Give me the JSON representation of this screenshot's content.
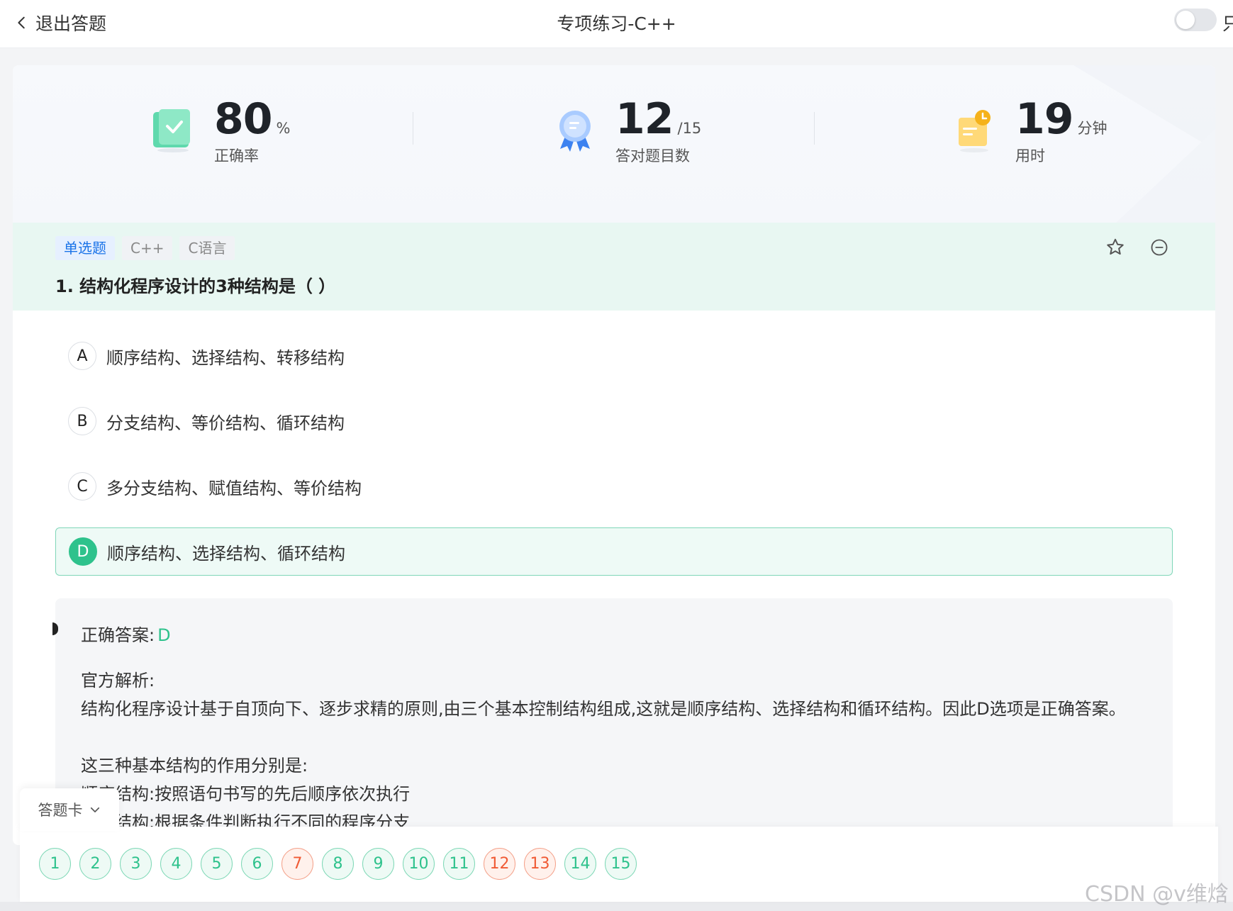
{
  "topbar": {
    "back_label": "退出答题",
    "title": "专项练习-C++",
    "toggle_label": "只"
  },
  "stats": {
    "accuracy": {
      "value": "80",
      "unit": "%",
      "label": "正确率"
    },
    "correct": {
      "value": "12",
      "unit": "/15",
      "label": "答对题目数"
    },
    "time": {
      "value": "19",
      "unit": "分钟",
      "label": "用时"
    }
  },
  "question": {
    "tags": [
      "单选题",
      "C++",
      "C语言"
    ],
    "title": "1. 结构化程序设计的3种结构是（ ）",
    "options": [
      {
        "letter": "A",
        "text": "顺序结构、选择结构、转移结构"
      },
      {
        "letter": "B",
        "text": "分支结构、等价结构、循环结构"
      },
      {
        "letter": "C",
        "text": "多分支结构、赋值结构、等价结构"
      },
      {
        "letter": "D",
        "text": "顺序结构、选择结构、循环结构"
      }
    ],
    "selected": "D"
  },
  "analysis": {
    "answer_label": "正确答案:",
    "answer_value": "D",
    "official_label": "官方解析:",
    "lines": [
      "结构化程序设计基于自顶向下、逐步求精的原则,由三个基本控制结构组成,这就是顺序结构、选择结构和循环结构。因此D选项是正确答案。",
      "",
      "这三种基本结构的作用分别是:",
      "顺序结构:按照语句书写的先后顺序依次执行",
      "选择结构:根据条件判断执行不同的程序分支"
    ]
  },
  "answer_sheet": {
    "label": "答题卡",
    "items": [
      {
        "n": "1",
        "status": "correct"
      },
      {
        "n": "2",
        "status": "correct"
      },
      {
        "n": "3",
        "status": "correct"
      },
      {
        "n": "4",
        "status": "correct"
      },
      {
        "n": "5",
        "status": "correct"
      },
      {
        "n": "6",
        "status": "correct"
      },
      {
        "n": "7",
        "status": "wrong"
      },
      {
        "n": "8",
        "status": "correct"
      },
      {
        "n": "9",
        "status": "correct"
      },
      {
        "n": "10",
        "status": "correct"
      },
      {
        "n": "11",
        "status": "correct"
      },
      {
        "n": "12",
        "status": "wrong"
      },
      {
        "n": "13",
        "status": "wrong"
      },
      {
        "n": "14",
        "status": "correct"
      },
      {
        "n": "15",
        "status": "correct"
      }
    ]
  },
  "watermark": "CSDN @v维焓",
  "colors": {
    "primary_green": "#2ec28c",
    "wrong_red": "#f05a34",
    "tag_blue": "#1a73e8"
  }
}
